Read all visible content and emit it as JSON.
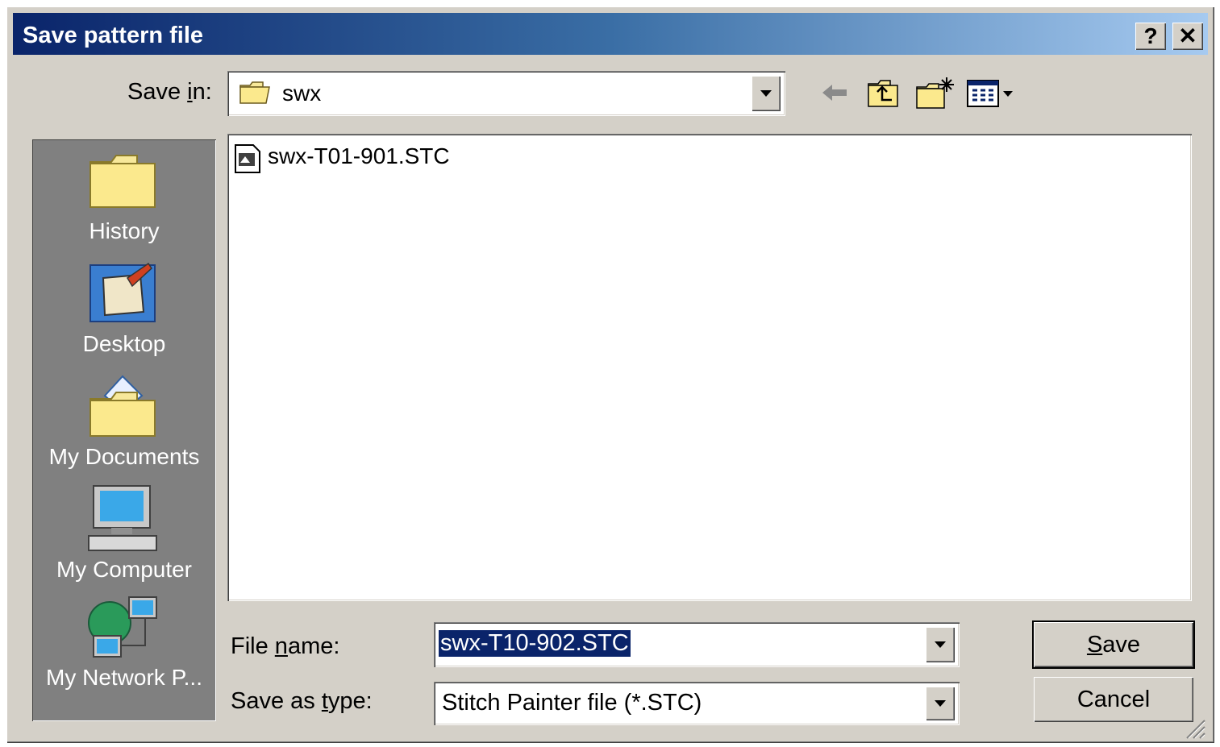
{
  "window": {
    "title": "Save pattern file",
    "help_label": "?",
    "close_label": "✕"
  },
  "save_in": {
    "label_pre": "Save ",
    "label_accel": "i",
    "label_post": "n:",
    "value": "swx"
  },
  "toolbar": {
    "icons": [
      "back-arrow-icon",
      "up-one-level-icon",
      "new-folder-icon",
      "view-menu-icon"
    ]
  },
  "places": [
    {
      "label": "History",
      "icon": "history-folder-icon"
    },
    {
      "label": "Desktop",
      "icon": "desktop-icon"
    },
    {
      "label": "My Documents",
      "icon": "my-documents-icon"
    },
    {
      "label": "My Computer",
      "icon": "my-computer-icon"
    },
    {
      "label": "My Network P...",
      "icon": "network-places-icon"
    }
  ],
  "files": [
    {
      "name": "swx-T01-901.STC",
      "icon": "stc-file-icon"
    }
  ],
  "file_name": {
    "label_pre": "File ",
    "label_accel": "n",
    "label_post": "ame:",
    "value": "swx-T10-902.STC"
  },
  "save_as_type": {
    "label_pre": "Save as ",
    "label_accel": "t",
    "label_post": "ype:",
    "value": "Stitch Painter file (*.STC)"
  },
  "buttons": {
    "save_accel": "S",
    "save_rest": "ave",
    "cancel": "Cancel"
  },
  "colors": {
    "title_start": "#0a246a",
    "title_end": "#a6caf0",
    "selection": "#0a246a",
    "face": "#d4d0c8",
    "places_bg": "#808080"
  }
}
